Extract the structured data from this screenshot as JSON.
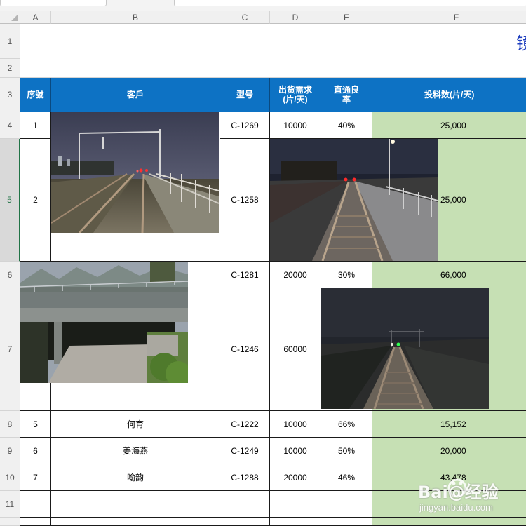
{
  "columns": [
    "A",
    "B",
    "C",
    "D",
    "E",
    "F"
  ],
  "rows": [
    "1",
    "2",
    "3",
    "4",
    "5",
    "6",
    "7",
    "8",
    "9",
    "10",
    "11"
  ],
  "selected_row": "5",
  "title_fragment": "镜",
  "headers": {
    "seq": "序號",
    "customer": "客戶",
    "model": "型号",
    "demand": "出货需求(片/天)",
    "yield": "直通良率",
    "input": "投料数(片/天)"
  },
  "data_rows": [
    {
      "seq": "1",
      "customer": "",
      "model": "C-1269",
      "demand": "10000",
      "yield": "40%",
      "input": "25,000"
    },
    {
      "seq": "2",
      "customer": "",
      "model": "C-1258",
      "demand": "",
      "yield": "",
      "input": "25,000"
    },
    {
      "seq": "",
      "customer": "",
      "model": "C-1281",
      "demand": "20000",
      "yield": "30%",
      "input": "66,000"
    },
    {
      "seq": "",
      "customer": "",
      "model": "C-1246",
      "demand": "60000",
      "yield": "",
      "input": ""
    },
    {
      "seq": "5",
      "customer": "何育",
      "model": "C-1222",
      "demand": "10000",
      "yield": "66%",
      "input": "15,152"
    },
    {
      "seq": "6",
      "customer": "姜海燕",
      "model": "C-1249",
      "demand": "10000",
      "yield": "50%",
      "input": "20,000"
    },
    {
      "seq": "7",
      "customer": "喻韵",
      "model": "C-1288",
      "demand": "20000",
      "yield": "46%",
      "input": "43,478"
    }
  ],
  "photos": [
    {
      "name": "railway-dusk-photo",
      "subject": "railway track at dusk with catenary poles"
    },
    {
      "name": "railway-night-photo-1",
      "subject": "railway track at night with red signal lights"
    },
    {
      "name": "bridge-photo",
      "subject": "concrete railway bridge with mountains"
    },
    {
      "name": "railway-night-photo-2",
      "subject": "railway track at night with green signal light"
    }
  ],
  "watermark": {
    "brand": "Bai@经验",
    "url": "jingyan.baidu.com"
  },
  "colors": {
    "header_blue": "#0d72c4",
    "green_fill": "#c6e0b4",
    "title_blue": "#1f3fbf"
  }
}
